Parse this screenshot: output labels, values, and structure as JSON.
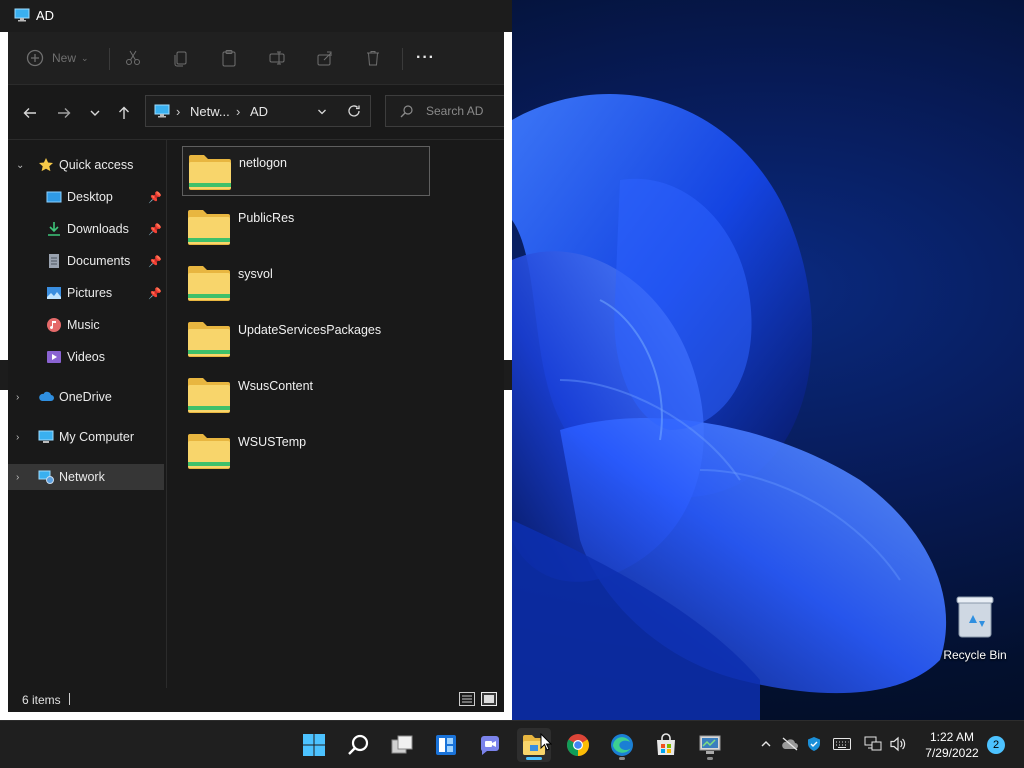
{
  "window": {
    "title": "AD"
  },
  "toolbar": {
    "new_label": "New",
    "more_label": "···"
  },
  "address": {
    "crumbs": [
      "Netw...",
      "AD"
    ],
    "search_placeholder": "Search AD"
  },
  "navpane": {
    "quick_access": "Quick access",
    "items": [
      {
        "label": "Desktop",
        "icon": "desktop-folder-icon",
        "pinned": true
      },
      {
        "label": "Downloads",
        "icon": "downloads-folder-icon",
        "pinned": true
      },
      {
        "label": "Documents",
        "icon": "documents-folder-icon",
        "pinned": true
      },
      {
        "label": "Pictures",
        "icon": "pictures-folder-icon",
        "pinned": true
      },
      {
        "label": "Music",
        "icon": "music-folder-icon",
        "pinned": false
      },
      {
        "label": "Videos",
        "icon": "videos-folder-icon",
        "pinned": false
      }
    ],
    "onedrive": "OneDrive",
    "my_computer": "My Computer",
    "network": "Network"
  },
  "files": [
    "netlogon",
    "PublicRes",
    "sysvol",
    "UpdateServicesPackages",
    "WsusContent",
    "WSUSTemp"
  ],
  "status": {
    "item_count": "6 items"
  },
  "desktop": {
    "recycle_bin": "Recycle Bin"
  },
  "taskbar": {
    "apps": [
      "start-icon",
      "search-icon",
      "task-view-icon",
      "widgets-icon",
      "teams-chat-icon",
      "file-explorer-icon",
      "chrome-icon",
      "edge-icon",
      "store-icon",
      "server-manager-icon"
    ],
    "time": "1:22 AM",
    "date": "7/29/2022",
    "notifications": "2"
  },
  "colors": {
    "accent": "#4cc2ff",
    "folder": "#f8d56b",
    "window_bg": "#191919"
  }
}
